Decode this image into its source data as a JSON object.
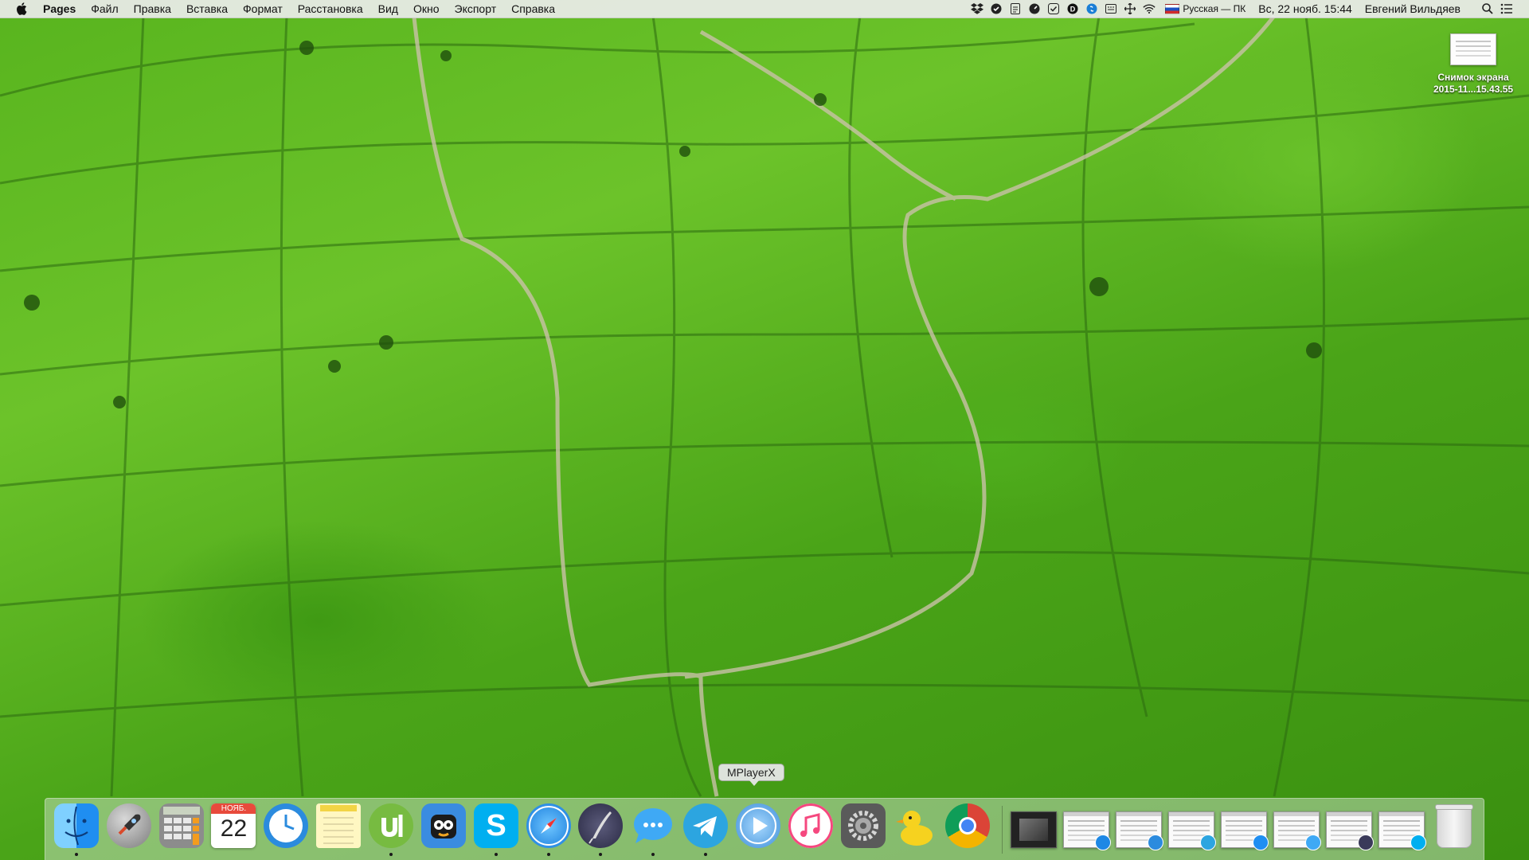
{
  "menubar": {
    "app_name": "Pages",
    "items": [
      "Файл",
      "Правка",
      "Вставка",
      "Формат",
      "Расстановка",
      "Вид",
      "Окно",
      "Экспорт",
      "Справка"
    ],
    "tray_icons": [
      "dropbox-icon",
      "shield-icon",
      "document-icon",
      "gauge-icon",
      "checkbox-icon",
      "identity-icon",
      "shazam-icon",
      "keyboard-icon",
      "move-icon",
      "wifi-icon"
    ],
    "input_source": "Русская — ПК",
    "clock": "Вс, 22 нояб. 15:44",
    "user": "Евгений Вильдяев"
  },
  "desktop": {
    "file_label_line1": "Снимок экрана",
    "file_label_line2": "2015-11...15.43.55"
  },
  "dock": {
    "tooltip": "MPlayerX",
    "calendar_month": "НОЯБ.",
    "calendar_day": "22",
    "apps": [
      {
        "name": "finder",
        "running": true
      },
      {
        "name": "launchpad",
        "running": false
      },
      {
        "name": "calculator",
        "running": false
      },
      {
        "name": "calendar",
        "running": false
      },
      {
        "name": "time",
        "running": false
      },
      {
        "name": "notes",
        "running": false
      },
      {
        "name": "utorrent",
        "running": true
      },
      {
        "name": "tweetbot",
        "running": false
      },
      {
        "name": "skype",
        "running": true
      },
      {
        "name": "safari",
        "running": true
      },
      {
        "name": "quill",
        "running": true
      },
      {
        "name": "messages",
        "running": true
      },
      {
        "name": "telegram",
        "running": true
      },
      {
        "name": "mplayerx",
        "running": false
      },
      {
        "name": "itunes",
        "running": false
      },
      {
        "name": "system-preferences",
        "running": false
      },
      {
        "name": "cyberduck",
        "running": false
      },
      {
        "name": "chrome",
        "running": false
      }
    ],
    "colors": {
      "finder": "#1f8ef1",
      "skype": "#00aff0",
      "telegram": "#2ca5e0",
      "chrome_red": "#db4437",
      "chrome_green": "#0f9d58",
      "chrome_yellow": "#f4b400"
    }
  }
}
